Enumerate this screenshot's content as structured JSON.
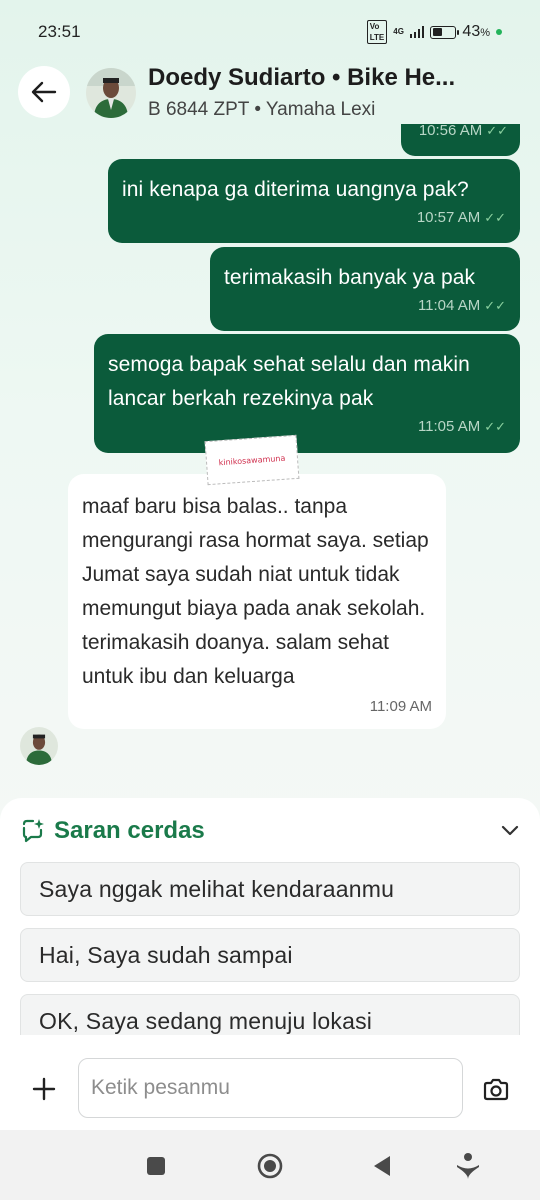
{
  "status_bar": {
    "time": "23:51",
    "sim": "VoLTE",
    "network": "4G",
    "battery": "43",
    "battery_unit": "%",
    "battery_level": 0.43
  },
  "header": {
    "driver_name": "Doedy Sudiarto • Bike He...",
    "vehicle": "B 6844 ZPT • Yamaha Lexi"
  },
  "messages": [
    {
      "direction": "out",
      "text": "",
      "time": "10:56 AM"
    },
    {
      "direction": "out",
      "text": "ini kenapa ga diterima uangnya pak?",
      "time": "10:57 AM"
    },
    {
      "direction": "out",
      "text": "terimakasih banyak ya pak",
      "time": "11:04 AM"
    },
    {
      "direction": "out",
      "text": "semoga bapak sehat selalu dan makin lancar berkah rezekinya pak",
      "time": "11:05 AM"
    },
    {
      "direction": "in",
      "text": "maaf baru bisa balas.. tanpa mengurangi rasa hormat saya. setiap Jumat saya sudah niat untuk tidak memungut biaya pada anak sekolah. terimakasih doanya. salam sehat untuk ibu dan keluarga",
      "time": "11:09 AM"
    }
  ],
  "sticker_text": "kinikosawamuna",
  "smart_replies": {
    "title": "Saran cerdas",
    "items": [
      "Saya nggak melihat kendaraanmu",
      "Hai, Saya sudah sampai",
      "OK, Saya sedang menuju lokasi"
    ]
  },
  "input": {
    "placeholder": "Ketik pesanmu"
  },
  "colors": {
    "outgoing_bubble": "#0b5b3b",
    "accent": "#1a7a4a"
  }
}
